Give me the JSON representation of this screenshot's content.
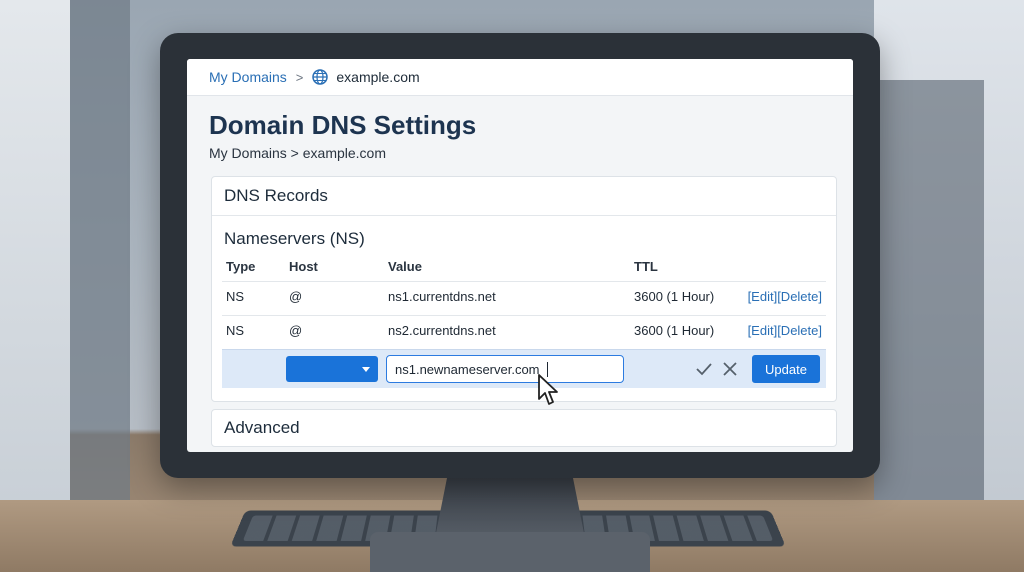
{
  "nav": {
    "root_link": "My Domains",
    "separator": ">",
    "domain": "example.com"
  },
  "page": {
    "title": "Domain DNS Settings",
    "breadcrumb": "My Domains > example.com"
  },
  "dns_card": {
    "header": "DNS Records",
    "section_title": "Nameservers (NS)",
    "columns": [
      "Type",
      "Host",
      "Value",
      "TTL"
    ],
    "records": [
      {
        "type": "NS",
        "host": "@",
        "value": "ns1.currentdns.net",
        "ttl": "3600 (1 Hour)",
        "edit": "[Edit]",
        "delete": "[Delete]"
      },
      {
        "type": "NS",
        "host": "@",
        "value": "ns2.currentdns.net",
        "ttl": "3600 (1 Hour)",
        "edit": "[Edit]",
        "delete": "[Delete]"
      }
    ],
    "edit_row": {
      "type_value": "",
      "value_input": "ns1.newnameserver.com",
      "update_label": "Update",
      "confirm_icon": "check-icon",
      "cancel_icon": "close-icon"
    }
  },
  "advanced_card": {
    "header": "Advanced"
  },
  "colors": {
    "accent": "#1a73d9",
    "link": "#2a6fb5",
    "title": "#1d3450",
    "edit_row_bg": "#dde9f8"
  }
}
